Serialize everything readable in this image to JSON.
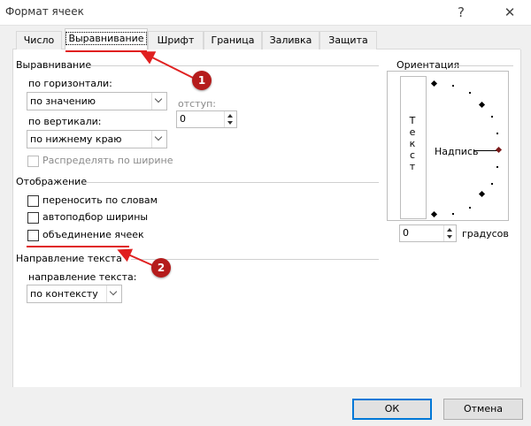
{
  "window": {
    "title": "Формат ячеек",
    "help_label": "?",
    "close_label": "✕"
  },
  "tabs": [
    {
      "label": "Число"
    },
    {
      "label": "Выравнивание"
    },
    {
      "label": "Шрифт"
    },
    {
      "label": "Граница"
    },
    {
      "label": "Заливка"
    },
    {
      "label": "Защита"
    }
  ],
  "alignment": {
    "section_title": "Выравнивание",
    "horizontal_label": "по горизонтали:",
    "horizontal_value": "по значению",
    "indent_label": "отступ:",
    "indent_value": "0",
    "vertical_label": "по вертикали:",
    "vertical_value": "по нижнему краю",
    "distribute_label": "Распределять по ширине"
  },
  "display": {
    "section_title": "Отображение",
    "wrap_label": "переносить по словам",
    "shrink_label": "автоподбор ширины",
    "merge_label": "объединение ячеек"
  },
  "text_direction": {
    "section_title": "Направление текста",
    "direction_label": "направление текста:",
    "direction_value": "по контексту"
  },
  "orientation": {
    "section_title": "Ориентация",
    "vertical_text": "Т\nе\nк\nс\nт",
    "inscription": "Надпись",
    "degrees_value": "0",
    "degrees_label": "градусов"
  },
  "annotations": {
    "badge1": "1",
    "badge2": "2"
  },
  "footer": {
    "ok_label": "ОК",
    "cancel_label": "Отмена"
  },
  "colors": {
    "annotation_red": "#e02020",
    "badge_red": "#b51c1c",
    "ok_border": "#0078d7"
  }
}
